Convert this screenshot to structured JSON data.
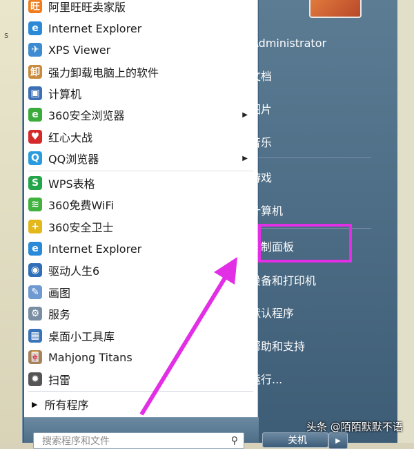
{
  "background": {
    "side_text": "s"
  },
  "programs": [
    {
      "label": "阿里旺旺卖家版",
      "icon": "aliwangwang-icon",
      "color": "#f07c1c",
      "glyph": "旺",
      "submenu": false
    },
    {
      "label": "Internet Explorer",
      "icon": "internet-explorer-icon",
      "color": "#2a8ad8",
      "glyph": "e",
      "submenu": false
    },
    {
      "label": "XPS Viewer",
      "icon": "xps-viewer-icon",
      "color": "#3d8bd0",
      "glyph": "✈",
      "submenu": false
    },
    {
      "label": "强力卸载电脑上的软件",
      "icon": "uninstaller-icon",
      "color": "#c98a3b",
      "glyph": "卸",
      "submenu": false
    },
    {
      "label": "计算机",
      "icon": "computer-icon",
      "color": "#3c6fb5",
      "glyph": "▣",
      "submenu": false
    },
    {
      "label": "360安全浏览器",
      "icon": "360-browser-icon",
      "color": "#3bab3b",
      "glyph": "e",
      "submenu": true
    },
    {
      "label": "红心大战",
      "icon": "hearts-game-icon",
      "color": "#d52a2a",
      "glyph": "♥",
      "submenu": false
    },
    {
      "label": "QQ浏览器",
      "icon": "qq-browser-icon",
      "color": "#2b9be0",
      "glyph": "Q",
      "submenu": true
    },
    {
      "label": "WPS表格",
      "icon": "wps-spreadsheet-icon",
      "color": "#23a64a",
      "glyph": "S",
      "submenu": false
    },
    {
      "label": "360免费WiFi",
      "icon": "360-wifi-icon",
      "color": "#41b23e",
      "glyph": "≋",
      "submenu": false
    },
    {
      "label": "360安全卫士",
      "icon": "360-security-icon",
      "color": "#e3b81b",
      "glyph": "+",
      "submenu": false
    },
    {
      "label": "Internet Explorer",
      "icon": "internet-explorer-icon",
      "color": "#2a8ad8",
      "glyph": "e",
      "submenu": false
    },
    {
      "label": "驱动人生6",
      "icon": "driver-life-icon",
      "color": "#2f6fb8",
      "glyph": "◉",
      "submenu": false
    },
    {
      "label": "画图",
      "icon": "paint-icon",
      "color": "#6f9ad1",
      "glyph": "✎",
      "submenu": false
    },
    {
      "label": "服务",
      "icon": "services-icon",
      "color": "#7a8ea3",
      "glyph": "⚙",
      "submenu": false
    },
    {
      "label": "桌面小工具库",
      "icon": "gadgets-icon",
      "color": "#3a74b8",
      "glyph": "▦",
      "submenu": false
    },
    {
      "label": "Mahjong Titans",
      "icon": "mahjong-icon",
      "color": "#a7835a",
      "glyph": "🀄",
      "submenu": false
    },
    {
      "label": "扫雷",
      "icon": "minesweeper-icon",
      "color": "#555555",
      "glyph": "✹",
      "submenu": false
    }
  ],
  "all_programs_label": "所有程序",
  "search_placeholder": "搜索程序和文件",
  "right_menu": [
    {
      "label": "Administrator",
      "name": "administrator"
    },
    {
      "label": "文档",
      "name": "documents"
    },
    {
      "label": "图片",
      "name": "pictures"
    },
    {
      "label": "音乐",
      "name": "music"
    },
    {
      "label": "游戏",
      "name": "games"
    },
    {
      "label": "计算机",
      "name": "computer"
    },
    {
      "label": "控制面板",
      "name": "control-panel"
    },
    {
      "label": "设备和打印机",
      "name": "devices-printers"
    },
    {
      "label": "默认程序",
      "name": "default-programs"
    },
    {
      "label": "帮助和支持",
      "name": "help-support"
    },
    {
      "label": "运行...",
      "name": "run"
    }
  ],
  "shutdown_label": "关机",
  "watermark": "头条 @陌陌默默不语",
  "accent_highlight": "#e22fe6"
}
